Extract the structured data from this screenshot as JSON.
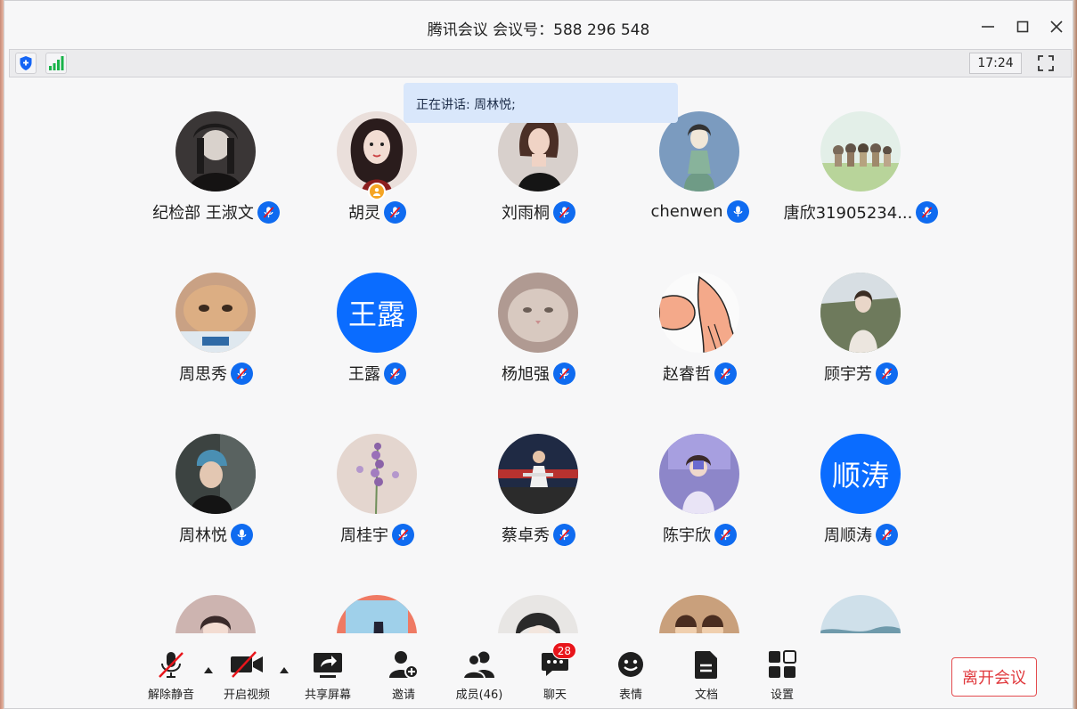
{
  "window": {
    "title": "腾讯会议 会议号：588 296 548"
  },
  "infobar": {
    "time": "17:24",
    "security_icon": "shield-icon",
    "network_icon": "signal-icon"
  },
  "speaking_banner": "正在讲话: 周林悦;",
  "participants": [
    {
      "name": "纪检部 王淑文",
      "avatar": "photo",
      "mic": "muted"
    },
    {
      "name": "胡灵",
      "avatar": "photo",
      "mic": "muted",
      "host": true
    },
    {
      "name": "刘雨桐",
      "avatar": "photo",
      "mic": "muted"
    },
    {
      "name": "chenwen",
      "avatar": "photo",
      "mic": "on"
    },
    {
      "name": "唐欣31905234...",
      "avatar": "photo",
      "mic": "muted"
    },
    {
      "name": "周思秀",
      "avatar": "photo",
      "mic": "muted"
    },
    {
      "name": "王露",
      "avatar": "text",
      "avatar_text": "王露",
      "mic": "muted"
    },
    {
      "name": "杨旭强",
      "avatar": "photo",
      "mic": "muted"
    },
    {
      "name": "赵睿哲",
      "avatar": "photo",
      "mic": "muted"
    },
    {
      "name": "顾宇芳",
      "avatar": "photo",
      "mic": "muted"
    },
    {
      "name": "周林悦",
      "avatar": "photo",
      "mic": "on"
    },
    {
      "name": "周桂宇",
      "avatar": "photo",
      "mic": "muted"
    },
    {
      "name": "蔡卓秀",
      "avatar": "photo",
      "mic": "muted"
    },
    {
      "name": "陈宇欣",
      "avatar": "photo",
      "mic": "muted"
    },
    {
      "name": "周顺涛",
      "avatar": "text",
      "avatar_text": "顺涛",
      "mic": "muted"
    }
  ],
  "toolbar": {
    "unmute": "解除静音",
    "start_video": "开启视频",
    "share_screen": "共享屏幕",
    "invite": "邀请",
    "members": "成员(46)",
    "chat": "聊天",
    "chat_badge": "28",
    "reactions": "表情",
    "docs": "文档",
    "settings": "设置",
    "leave": "离开会议"
  },
  "colors": {
    "accent": "#0a6cff",
    "leave": "#e0393d",
    "badge": "#e8151b",
    "mute_slash": "#e8151b"
  }
}
